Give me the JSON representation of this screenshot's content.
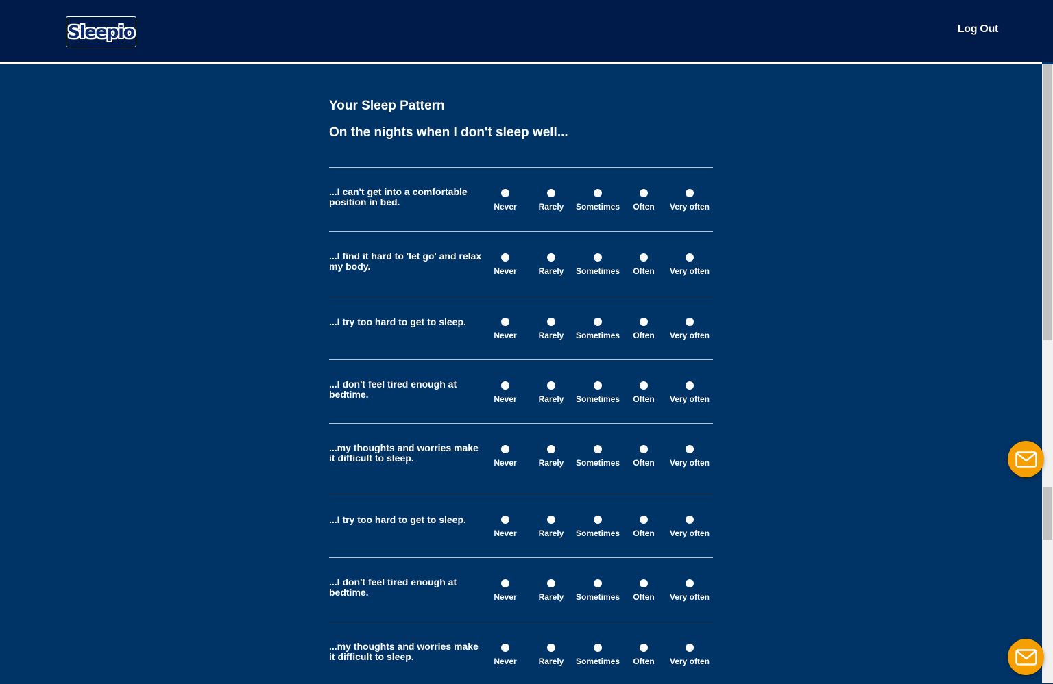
{
  "header": {
    "logo_text": "Sleepio",
    "logout_label": "Log Out"
  },
  "page": {
    "title": "Your Sleep Pattern",
    "subtitle": "On the nights when I don't sleep well..."
  },
  "options": [
    "Never",
    "Rarely",
    "Sometimes",
    "Often",
    "Very often"
  ],
  "questions": [
    {
      "text": "...I can't get into a comfortable position in bed."
    },
    {
      "text": "...I find it hard to 'let go' and relax my body."
    },
    {
      "text": "...I try too hard to get to sleep."
    },
    {
      "text": "...I don't feel tired enough at bedtime."
    },
    {
      "text": "...my thoughts and worries make it difficult to sleep."
    },
    {
      "text": "...I try too hard to get to sleep."
    },
    {
      "text": "...I don't feel tired enough at bedtime."
    },
    {
      "text": "...my thoughts and worries make it difficult to sleep."
    }
  ],
  "colors": {
    "header_bg": "#001a4a",
    "page_bg": "#003366",
    "accent": "#f5a000"
  },
  "icons": {
    "chat": "envelope-icon"
  }
}
